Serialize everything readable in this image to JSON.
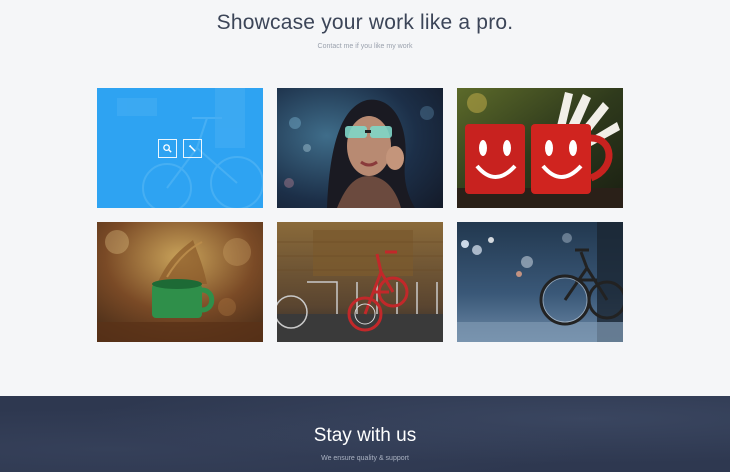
{
  "header": {
    "title": "Showcase your work like a pro.",
    "subtitle": "Contact me if you like my work"
  },
  "portfolio": {
    "items": [
      {
        "image": "blue overlay with bicycle",
        "hovered": true,
        "actions": [
          "search-icon",
          "link-icon"
        ]
      },
      {
        "image": "woman with sunglasses"
      },
      {
        "image": "red smiley mugs and open book"
      },
      {
        "image": "green cup with splash"
      },
      {
        "image": "red bicycle against brick wall"
      },
      {
        "image": "bicycle at night street"
      }
    ]
  },
  "footer": {
    "title": "Stay with us",
    "subtitle": "We ensure quality & support"
  },
  "colors": {
    "accent": "#2ea3f2",
    "title": "#3c4558",
    "footer_bg": "#2e3850"
  }
}
